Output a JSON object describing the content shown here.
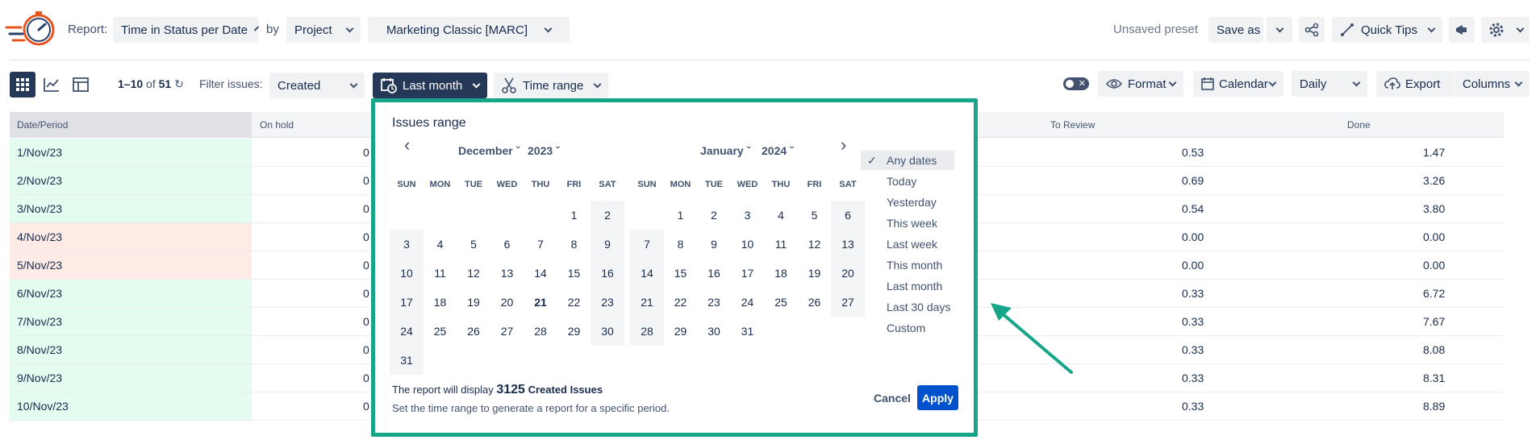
{
  "toolbar": {
    "report_label": "Report:",
    "report_value": "Time in Status per Date",
    "by_label": "by",
    "group_value": "Project",
    "project_value": "Marketing Classic [MARC]",
    "unsaved": "Unsaved preset",
    "save_as": "Save as",
    "quick_tips": "Quick Tips"
  },
  "filterbar": {
    "pagination_range": "1–10",
    "pagination_of": "of",
    "pagination_total": "51",
    "filter_label": "Filter issues:",
    "filter_field": "Created",
    "period": "Last month",
    "time_range": "Time range",
    "format": "Format",
    "calendar": "Calendar",
    "granularity": "Daily",
    "export": "Export",
    "columns": "Columns"
  },
  "table": {
    "headers": [
      "Date/Period",
      "On hold",
      "To Review",
      "Done"
    ],
    "rows": [
      {
        "date": "1/Nov/23",
        "onhold": "0",
        "review": "0.53",
        "done": "1.47",
        "status": "green"
      },
      {
        "date": "2/Nov/23",
        "onhold": "0",
        "review": "0.69",
        "done": "3.26",
        "status": "green"
      },
      {
        "date": "3/Nov/23",
        "onhold": "0",
        "review": "0.54",
        "done": "3.80",
        "status": "green"
      },
      {
        "date": "4/Nov/23",
        "onhold": "0",
        "review": "0.00",
        "done": "0.00",
        "status": "red"
      },
      {
        "date": "5/Nov/23",
        "onhold": "0",
        "review": "0.00",
        "done": "0.00",
        "status": "red"
      },
      {
        "date": "6/Nov/23",
        "onhold": "0",
        "review": "0.33",
        "done": "6.72",
        "status": "green"
      },
      {
        "date": "7/Nov/23",
        "onhold": "0",
        "review": "0.33",
        "done": "7.67",
        "status": "green"
      },
      {
        "date": "8/Nov/23",
        "onhold": "0",
        "review": "0.33",
        "done": "8.08",
        "status": "green"
      },
      {
        "date": "9/Nov/23",
        "onhold": "0",
        "review": "0.33",
        "done": "8.31",
        "status": "green"
      },
      {
        "date": "10/Nov/23",
        "onhold": "0",
        "review": "0.33",
        "done": "8.89",
        "status": "green"
      }
    ]
  },
  "popup": {
    "title": "Issues range",
    "left_month": "December",
    "left_year": "2023",
    "right_month": "January",
    "right_year": "2024",
    "weekdays": [
      "SUN",
      "MON",
      "TUE",
      "WED",
      "THU",
      "FRI",
      "SAT"
    ],
    "left_days": [
      "",
      "",
      "",
      "",
      "",
      "1",
      "2",
      "3",
      "4",
      "5",
      "6",
      "7",
      "8",
      "9",
      "10",
      "11",
      "12",
      "13",
      "14",
      "15",
      "16",
      "17",
      "18",
      "19",
      "20",
      "21",
      "22",
      "23",
      "24",
      "25",
      "26",
      "27",
      "28",
      "29",
      "30",
      "31"
    ],
    "right_days": [
      "",
      "1",
      "2",
      "3",
      "4",
      "5",
      "6",
      "7",
      "8",
      "9",
      "10",
      "11",
      "12",
      "13",
      "14",
      "15",
      "16",
      "17",
      "18",
      "19",
      "20",
      "21",
      "22",
      "23",
      "24",
      "25",
      "26",
      "27",
      "28",
      "29",
      "30",
      "31"
    ],
    "today": "21",
    "presets": [
      "Any dates",
      "Today",
      "Yesterday",
      "This week",
      "Last week",
      "This month",
      "Last month",
      "Last 30 days",
      "Custom"
    ],
    "selected_preset": "Any dates",
    "info_prefix": "The report will display",
    "info_count": "3125",
    "info_suffix": "Created Issues",
    "hint": "Set the time range to generate a report for a specific period.",
    "cancel": "Cancel",
    "apply": "Apply"
  },
  "colors": {
    "accent": "#0052cc",
    "highlight_border": "#16a589",
    "row_green": "#e3fcef",
    "row_red": "#ffebe6",
    "active_button": "#253858"
  }
}
